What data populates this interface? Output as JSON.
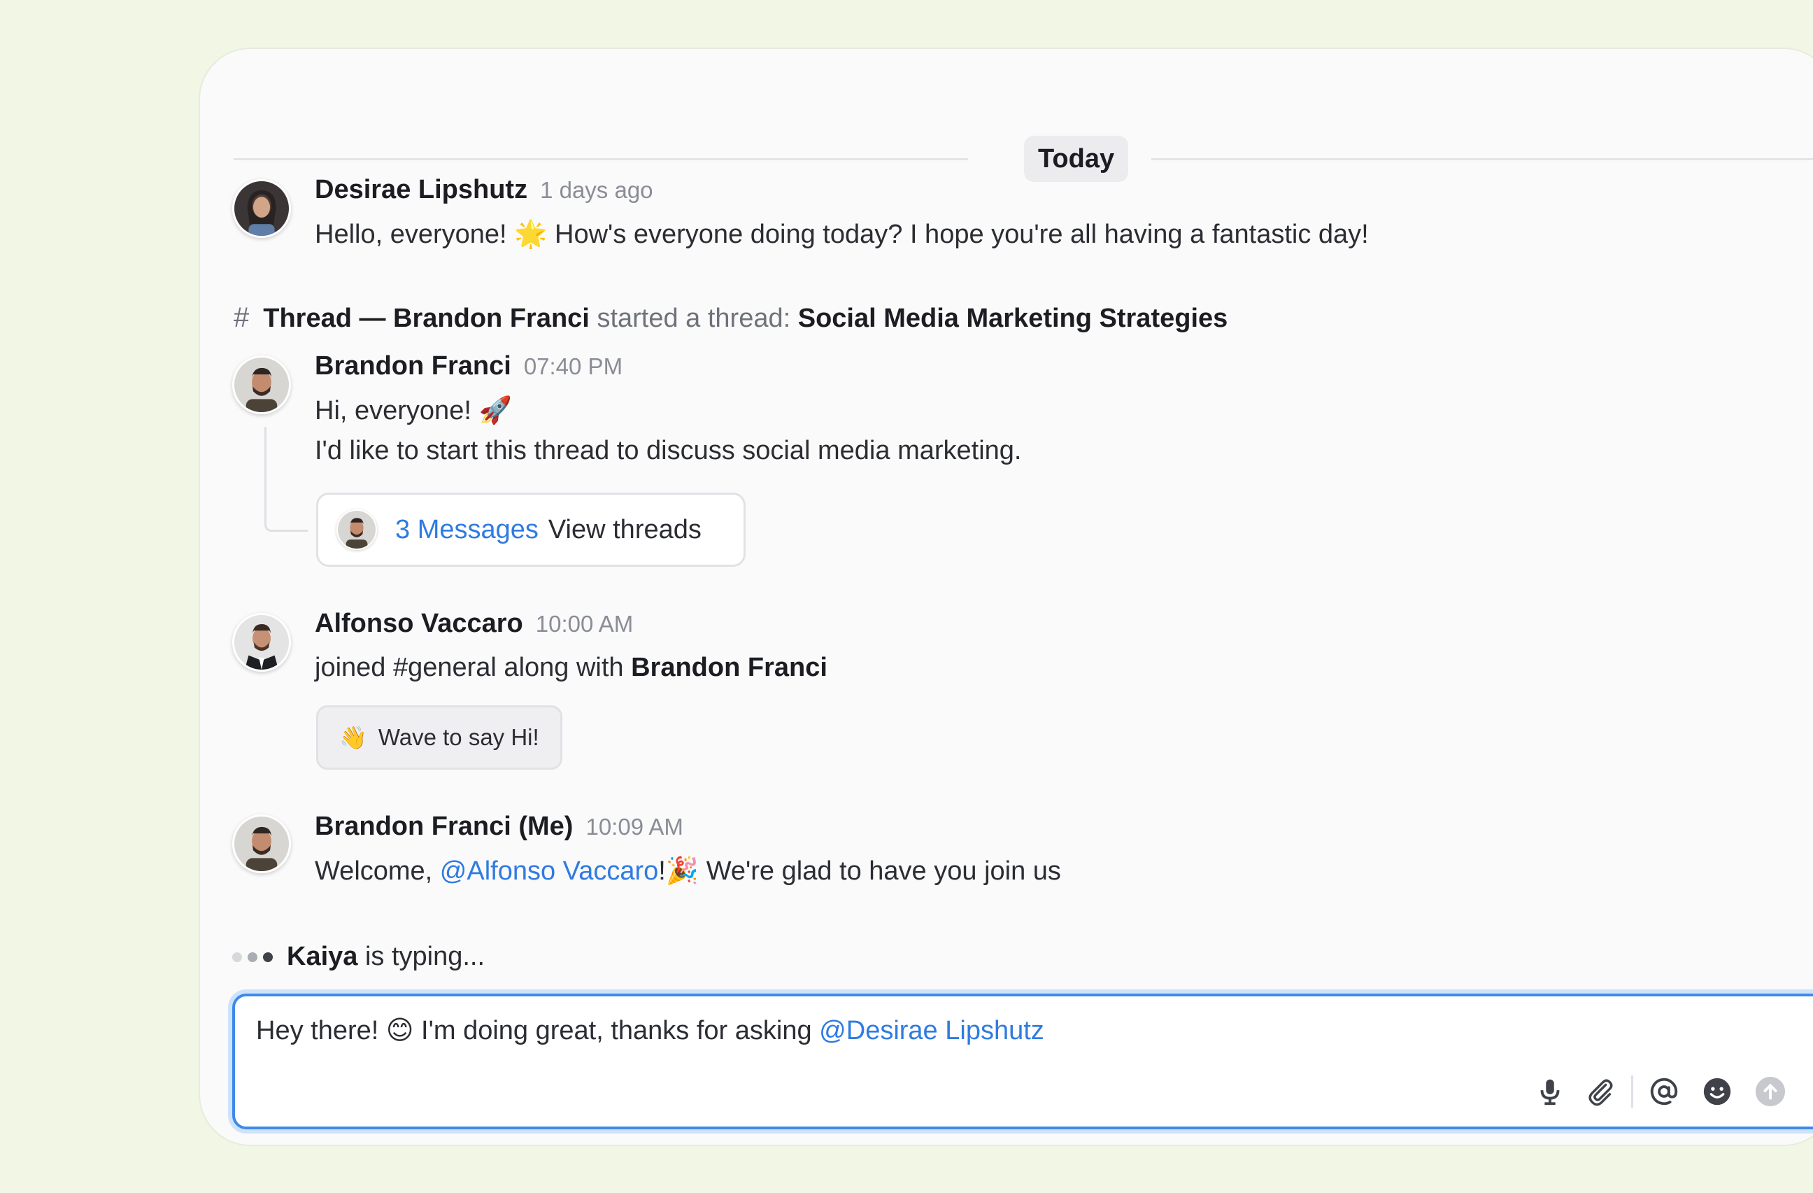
{
  "date_divider": "Today",
  "messages": [
    {
      "author": "Desirae Lipshutz",
      "time": "1 days ago",
      "text_before": "Hello, everyone! ",
      "emoji": "🌟",
      "text_after": " How's everyone doing today? I hope you're all having a fantastic day!"
    }
  ],
  "thread": {
    "prefix": "Thread — Brandon Franci",
    "started": "started a thread:",
    "title": "Social Media Marketing Strategies",
    "author": "Brandon Franci",
    "time": "07:40 PM",
    "line1": "Hi, everyone! ",
    "line1_emoji": "🚀",
    "line2": "I'd like to start this thread to discuss social media marketing.",
    "count_label": "3 Messages",
    "view_label": "View threads"
  },
  "join": {
    "author": "Alfonso Vaccaro",
    "time": "10:00 AM",
    "text": "joined #general along with ",
    "with_name": "Brandon Franci",
    "wave_emoji": "👋",
    "wave_label": "Wave to say Hi!"
  },
  "reply": {
    "author": "Brandon Franci (Me)",
    "time": "10:09 AM",
    "text_before": "Welcome, ",
    "mention": "@Alfonso Vaccaro",
    "bang": "!",
    "emoji": "🎉",
    "text_after": " We're glad to have you join us"
  },
  "typing": {
    "name": "Kaiya",
    "suffix": " is typing..."
  },
  "composer": {
    "text_before": "Hey there! ",
    "emoji": "😊",
    "text_after": " I'm doing great, thanks for asking ",
    "mention": "@Desirae Lipshutz"
  },
  "icons": [
    "microphone-icon",
    "paperclip-icon",
    "at-sign-icon",
    "emoji-icon",
    "send-icon"
  ],
  "colors": {
    "accent": "#2f7be0",
    "background": "#f1f7e4",
    "panel": "#fafafa"
  }
}
